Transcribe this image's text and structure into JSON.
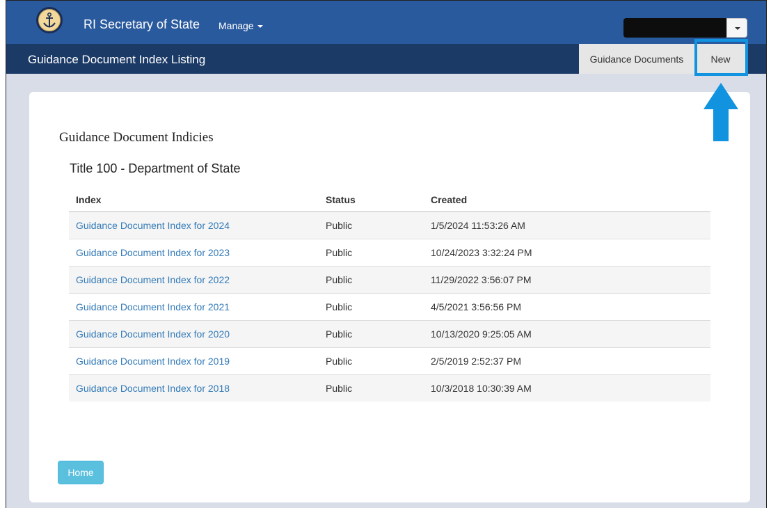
{
  "header": {
    "brand": "RI Secretary of State",
    "manage_label": "Manage",
    "seal_icon": "state-seal-icon"
  },
  "subheader": {
    "title": "Guidance Document Index Listing",
    "tabs": [
      {
        "label": "Guidance Documents"
      },
      {
        "label": "New"
      }
    ]
  },
  "main": {
    "heading": "Guidance Document Indicies",
    "section_title": "Title 100 - Department of State",
    "table": {
      "columns": [
        "Index",
        "Status",
        "Created"
      ],
      "rows": [
        {
          "index": "Guidance Document Index for 2024",
          "status": "Public",
          "created": "1/5/2024 11:53:26 AM"
        },
        {
          "index": "Guidance Document Index for 2023",
          "status": "Public",
          "created": "10/24/2023 3:32:24 PM"
        },
        {
          "index": "Guidance Document Index for 2022",
          "status": "Public",
          "created": "11/29/2022 3:56:07 PM"
        },
        {
          "index": "Guidance Document Index for 2021",
          "status": "Public",
          "created": "4/5/2021 3:56:56 PM"
        },
        {
          "index": "Guidance Document Index for 2020",
          "status": "Public",
          "created": "10/13/2020 9:25:05 AM"
        },
        {
          "index": "Guidance Document Index for 2019",
          "status": "Public",
          "created": "2/5/2019 2:52:37 PM"
        },
        {
          "index": "Guidance Document Index for 2018",
          "status": "Public",
          "created": "10/3/2018 10:30:39 AM"
        }
      ]
    },
    "home_label": "Home"
  },
  "colors": {
    "topbar": "#2a5a9e",
    "subbar": "#1b3a66",
    "link": "#337ab7",
    "highlight": "#1193e0",
    "home_button": "#5bc0de"
  }
}
